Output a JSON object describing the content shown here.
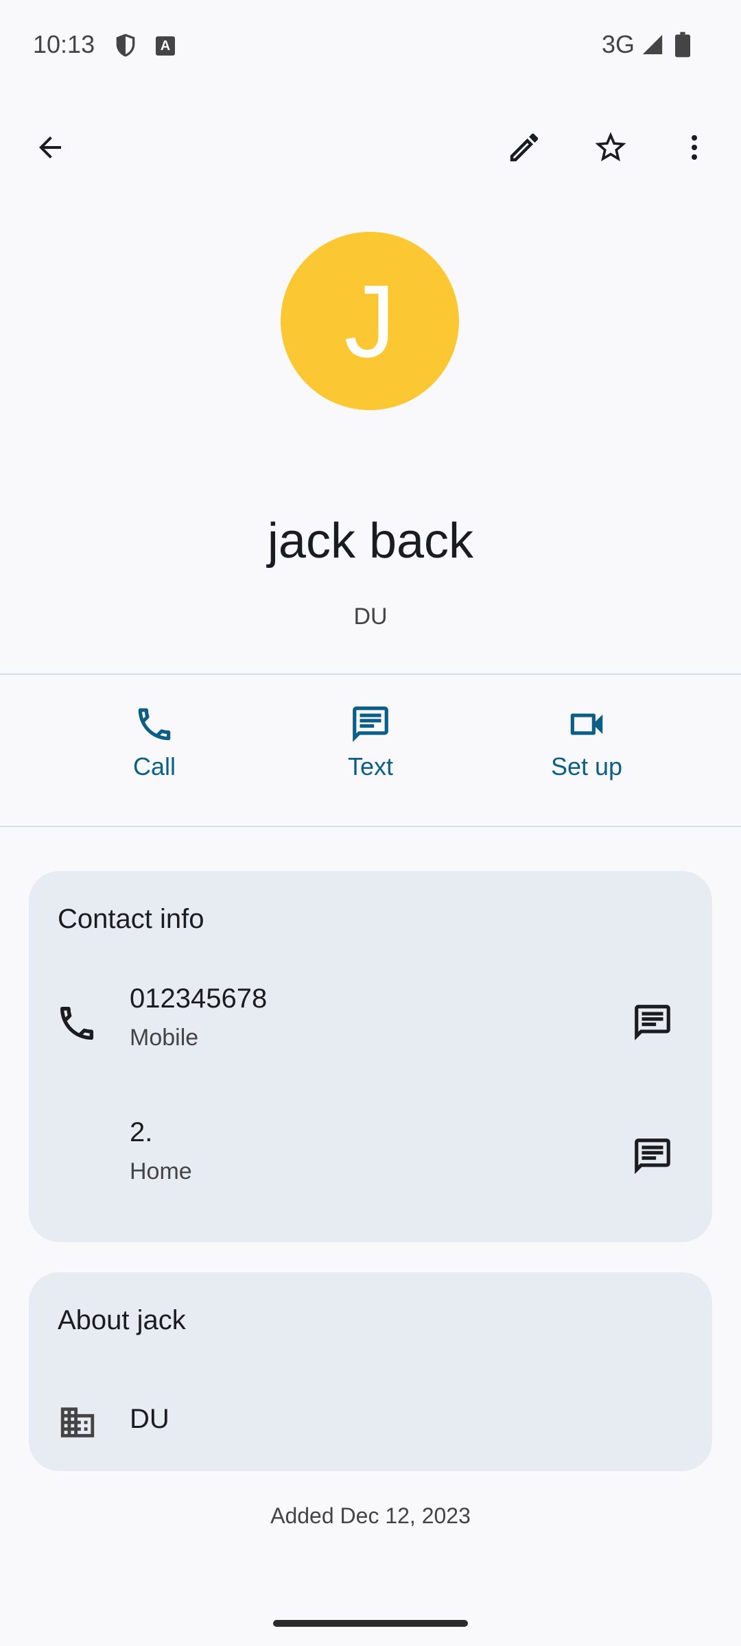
{
  "status_bar": {
    "time": "10:13",
    "network": "3G"
  },
  "contact": {
    "avatar_letter": "J",
    "avatar_color": "#fbc833",
    "name": "jack back",
    "company": "DU"
  },
  "actions": {
    "call": "Call",
    "text": "Text",
    "video": "Set up"
  },
  "contact_info": {
    "title": "Contact info",
    "entries": [
      {
        "value": "012345678",
        "type": "Mobile"
      },
      {
        "value": "2.",
        "type": "Home"
      }
    ]
  },
  "about": {
    "title": "About jack",
    "company": "DU"
  },
  "footer": {
    "added": "Added Dec 12, 2023"
  },
  "colors": {
    "accent": "#0b5f86",
    "card_bg": "#e6ecf2",
    "background": "#f9f9fc"
  }
}
